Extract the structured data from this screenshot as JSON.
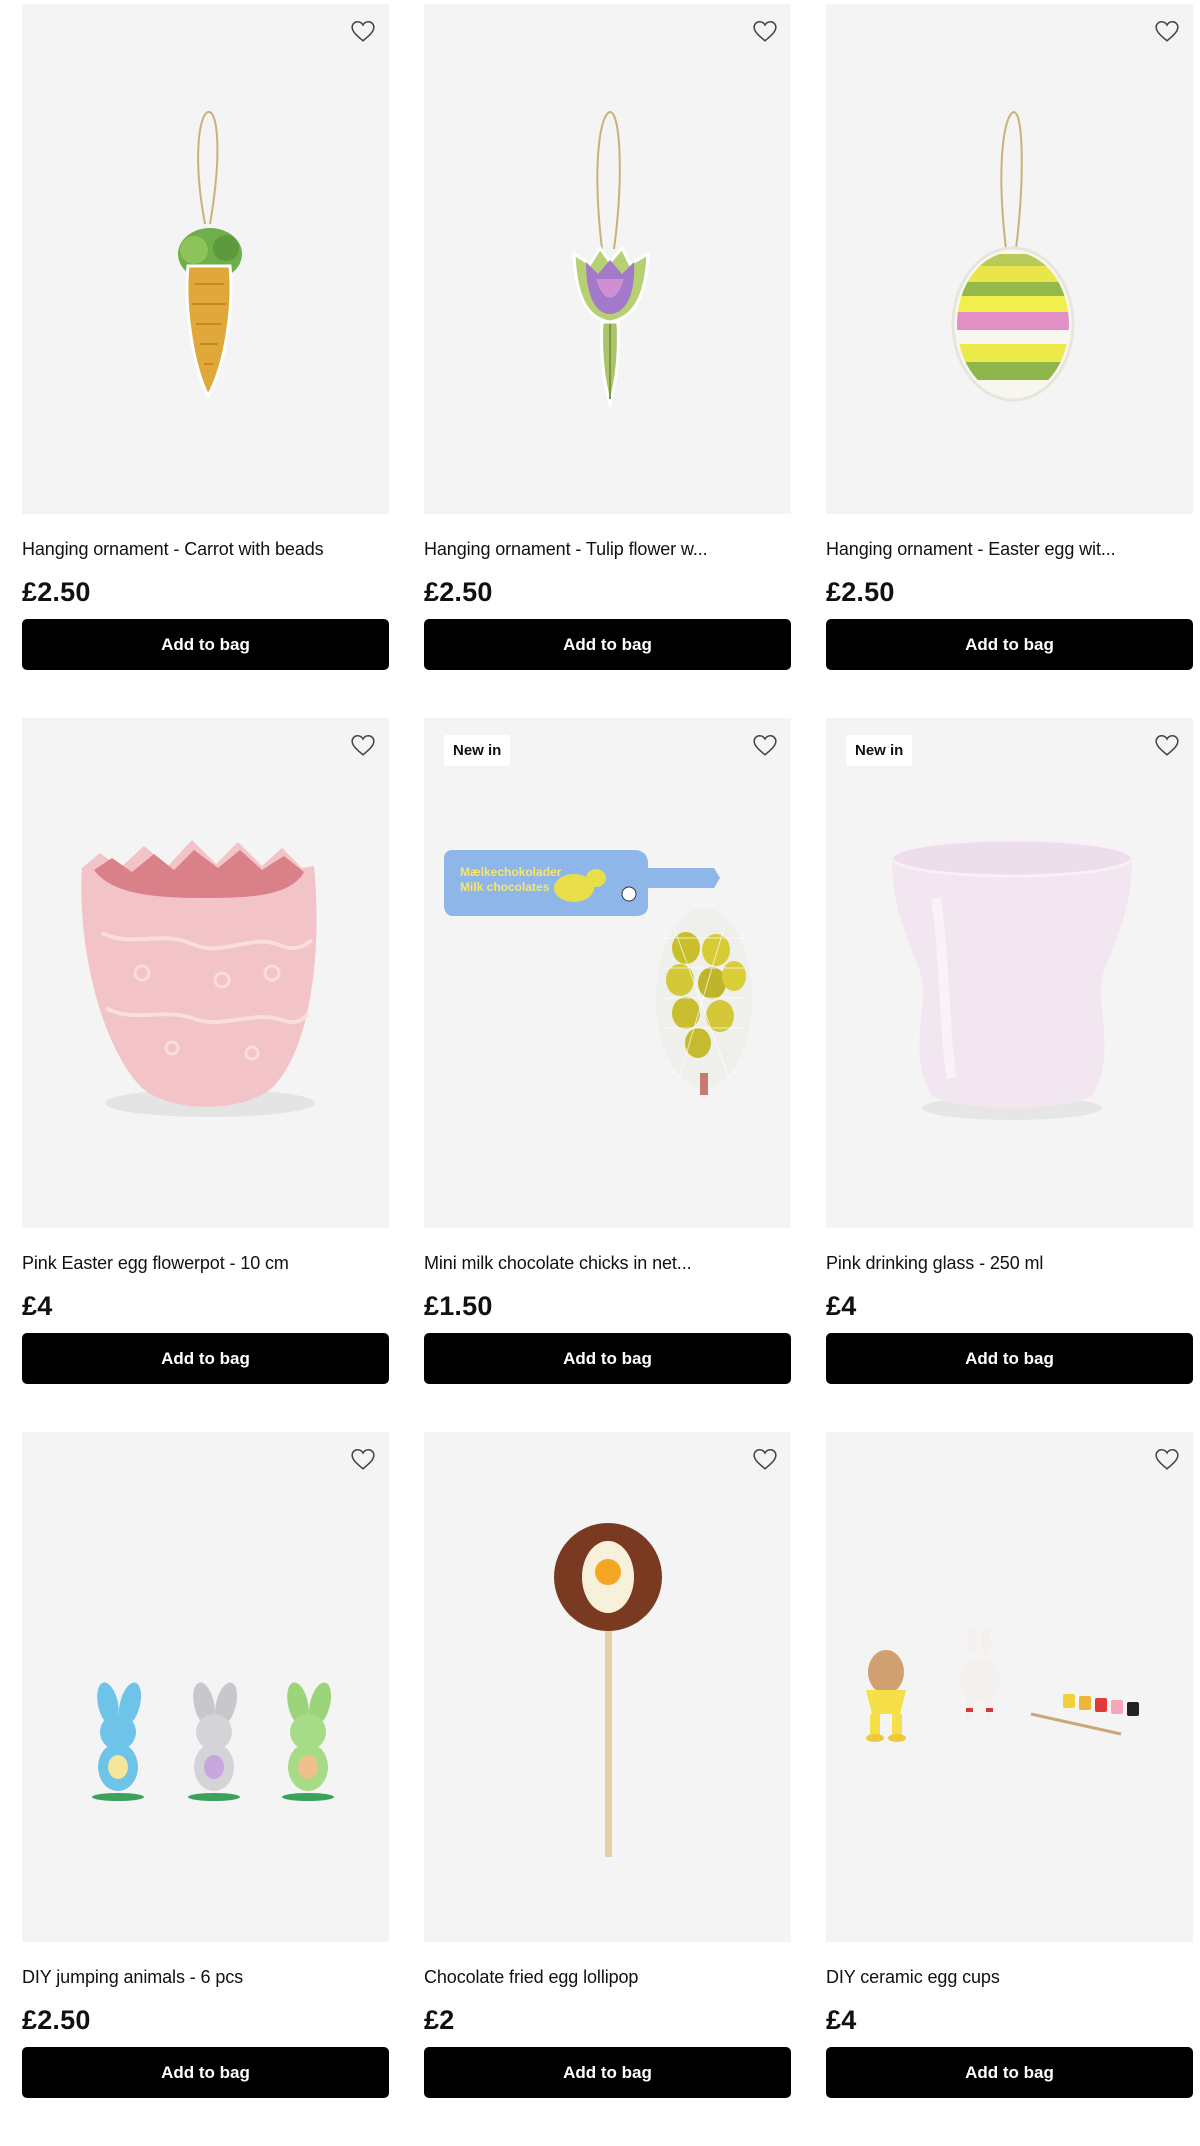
{
  "products": [
    {
      "title": "Hanging ornament - Carrot with beads",
      "price": "£2.50",
      "button": "Add to bag",
      "badge": "",
      "image": "carrot-ornament"
    },
    {
      "title": "Hanging ornament - Tulip flower w...",
      "price": "£2.50",
      "button": "Add to bag",
      "badge": "",
      "image": "tulip-ornament"
    },
    {
      "title": "Hanging ornament - Easter egg wit...",
      "price": "£2.50",
      "button": "Add to bag",
      "badge": "",
      "image": "egg-ornament"
    },
    {
      "title": "Pink Easter egg flowerpot - 10 cm",
      "price": "£4",
      "button": "Add to bag",
      "badge": "",
      "image": "pink-egg-flowerpot"
    },
    {
      "title": "Mini milk chocolate chicks in net...",
      "price": "£1.50",
      "button": "Add to bag",
      "badge": "New in",
      "image": "chocolate-chicks-net",
      "package_text": [
        "Mælkechokolader",
        "Milk chocolates"
      ]
    },
    {
      "title": "Pink drinking glass - 250 ml",
      "price": "£4",
      "button": "Add to bag",
      "badge": "New in",
      "image": "pink-drinking-glass"
    },
    {
      "title": "DIY jumping animals - 6 pcs",
      "price": "£2.50",
      "button": "Add to bag",
      "badge": "",
      "image": "jumping-bunnies"
    },
    {
      "title": "Chocolate fried egg lollipop",
      "price": "£2",
      "button": "Add to bag",
      "badge": "",
      "image": "fried-egg-lollipop"
    },
    {
      "title": "DIY ceramic egg cups",
      "price": "£4",
      "button": "Add to bag",
      "badge": "",
      "image": "ceramic-egg-cups"
    }
  ],
  "icons": {
    "favourite": "heart-outline-icon"
  },
  "colors": {
    "button_bg": "#000000",
    "button_text": "#ffffff",
    "card_bg": "#f4f4f4"
  }
}
